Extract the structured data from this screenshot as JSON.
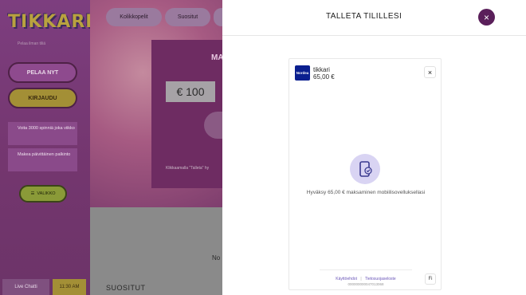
{
  "sidebar": {
    "logo": "TIKKARI",
    "tagline": "Pelaa ilman tiliä",
    "play_button": "PELAA NYT",
    "login_button": "KIRJAUDU",
    "promo_1": "Voita 3000 spinniä joka viikko",
    "promo_2": "Makea päivittäinen palkinto",
    "language_button": "VALIKKO",
    "live_chat": "Live Chatti",
    "clock": "11:30 AM"
  },
  "main": {
    "chips": [
      "Kolikkopelit",
      "Suositut",
      ""
    ],
    "hero_title": "MA",
    "amount_box": "€ 100",
    "hero_hint": "Klikkaamalla \"Talleta\" hy",
    "lower_text": "No",
    "section_title": "SUOSITUT"
  },
  "panel": {
    "title": "TALLETA TILILLESI",
    "close_symbol": "×"
  },
  "payment": {
    "bank_logo": "Nordea",
    "merchant": "tikkari",
    "amount": "65,00 €",
    "close_symbol": "×",
    "approve_text": "Hyväksy 65,00 € maksaminen mobiilisovelluksellasi",
    "footer_terms": "Käyttöehdot",
    "footer_privacy": "Tietosuojaseloste",
    "footer_id": "000000000047013068",
    "language": "Fi"
  },
  "colors": {
    "close_circle": "#5a1f5a",
    "bank_blue": "#0a1f8f",
    "phone_circle": "#d9d4f3",
    "link": "#6a56b8"
  }
}
